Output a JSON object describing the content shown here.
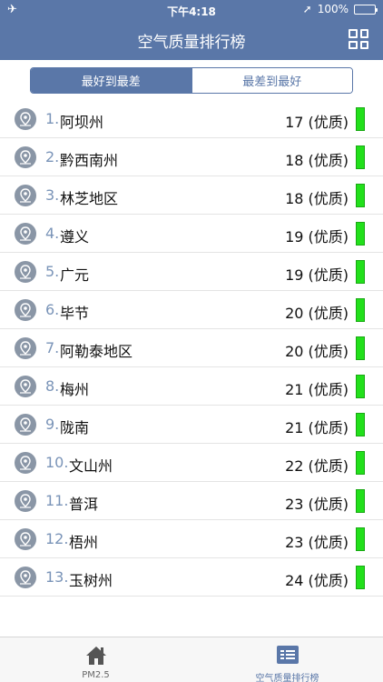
{
  "status": {
    "time": "下午4:18",
    "battery": "100%"
  },
  "header": {
    "title": "空气质量排行榜"
  },
  "segment": {
    "best_to_worst": "最好到最差",
    "worst_to_best": "最差到最好"
  },
  "rows": [
    {
      "rank": "1.",
      "city": "阿坝州",
      "value": "17 (优质)"
    },
    {
      "rank": "2.",
      "city": "黔西南州",
      "value": "18 (优质)"
    },
    {
      "rank": "3.",
      "city": "林芝地区",
      "value": "18 (优质)"
    },
    {
      "rank": "4.",
      "city": "遵义",
      "value": "19 (优质)"
    },
    {
      "rank": "5.",
      "city": "广元",
      "value": "19 (优质)"
    },
    {
      "rank": "6.",
      "city": "毕节",
      "value": "20 (优质)"
    },
    {
      "rank": "7.",
      "city": "阿勒泰地区",
      "value": "20 (优质)"
    },
    {
      "rank": "8.",
      "city": "梅州",
      "value": "21 (优质)"
    },
    {
      "rank": "9.",
      "city": "陇南",
      "value": "21 (优质)"
    },
    {
      "rank": "10.",
      "city": "文山州",
      "value": "22 (优质)"
    },
    {
      "rank": "11.",
      "city": "普洱",
      "value": "23 (优质)"
    },
    {
      "rank": "12.",
      "city": "梧州",
      "value": "23 (优质)"
    },
    {
      "rank": "13.",
      "city": "玉树州",
      "value": "24 (优质)"
    }
  ],
  "tabs": {
    "pm25": "PM2.5",
    "ranking": "空气质量排行榜"
  },
  "colors": {
    "brand": "#5a77a8",
    "quality_good": "#22e01b"
  }
}
